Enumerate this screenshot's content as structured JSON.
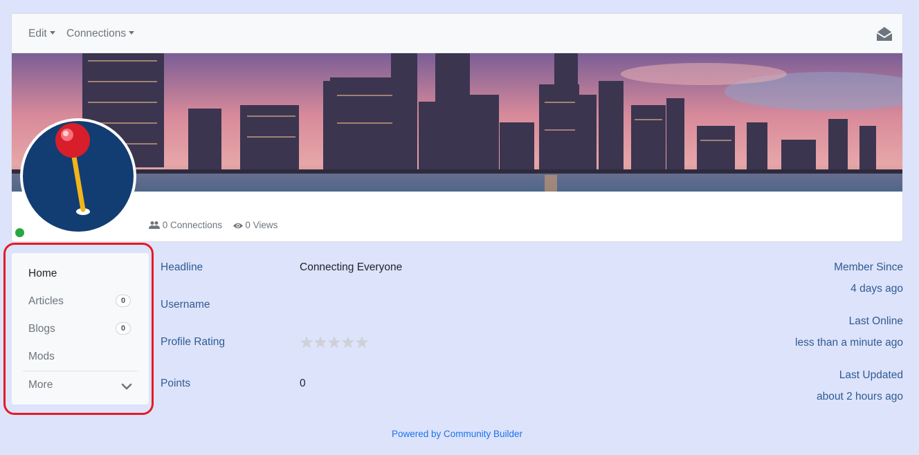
{
  "nav": {
    "edit_label": "Edit",
    "connections_label": "Connections",
    "inbox_icon": "envelope-open-icon"
  },
  "stats": {
    "connections": "0 Connections",
    "views": "0 Views",
    "connections_icon": "users-icon",
    "views_icon": "eye-icon"
  },
  "status": {
    "online": true,
    "color": "#28a745"
  },
  "sidebar": {
    "items": [
      {
        "label": "Home",
        "active": true
      },
      {
        "label": "Articles",
        "count": "0"
      },
      {
        "label": "Blogs",
        "count": "0"
      },
      {
        "label": "Mods"
      }
    ],
    "more_label": "More"
  },
  "fields": {
    "headline": {
      "label": "Headline",
      "value": "Connecting Everyone"
    },
    "username": {
      "label": "Username",
      "value": ""
    },
    "rating": {
      "label": "Profile Rating",
      "value": 0,
      "max": 5
    },
    "points": {
      "label": "Points",
      "value": "0"
    }
  },
  "meta": {
    "member_since": {
      "label": "Member Since",
      "value": "4 days ago"
    },
    "last_online": {
      "label": "Last Online",
      "value": "less than a minute ago"
    },
    "last_updated": {
      "label": "Last Updated",
      "value": "about 2 hours ago"
    }
  },
  "footer": {
    "text": "Powered by Community Builder"
  },
  "colors": {
    "background": "#dde3fb",
    "label": "#2f5b92",
    "link": "#1a73e8",
    "highlight_outline": "#e31b23",
    "avatar_bg": "#123d72",
    "pin_head": "#e31b23",
    "pin_stick": "#f2b51b"
  }
}
